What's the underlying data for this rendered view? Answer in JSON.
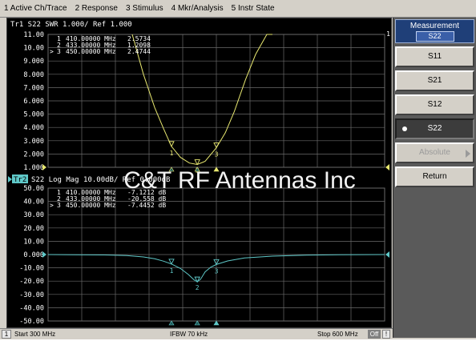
{
  "menu": [
    "1 Active Ch/Trace",
    "2 Response",
    "3 Stimulus",
    "4 Mkr/Analysis",
    "5 Instr State"
  ],
  "colors": {
    "trace1": "#e8e870",
    "trace2": "#5fc8c8",
    "grid": "#6a6a6a",
    "text_white": "#ffffff",
    "trace2_label_bg": "#5fc8c8",
    "watermark": "#ffffff"
  },
  "watermark": "C&T RF Antennas Inc",
  "trace1": {
    "header": "Tr1 S22 SWR 1.000/ Ref 1.000",
    "end_marker_label": "1",
    "y_ticks": [
      "11.00",
      "10.00",
      "9.000",
      "8.000",
      "7.000",
      "6.000",
      "5.000",
      "4.000",
      "3.000",
      "2.000",
      "1.000"
    ],
    "markers": [
      {
        "id": "1",
        "prefix": "",
        "freq": "410.00000 MHz",
        "value": "2.5734",
        "trace_value": 2.5734
      },
      {
        "id": "2",
        "prefix": "",
        "freq": "433.00000 MHz",
        "value": "1.2098",
        "trace_value": 1.2098
      },
      {
        "id": "3",
        "prefix": ">",
        "freq": "450.00000 MHz",
        "value": "2.4744",
        "trace_value": 2.4744
      }
    ]
  },
  "trace2": {
    "header_label": "Tr2",
    "header": "S22 Log Mag 10.00dB/ Ref 0.000dB",
    "y_ticks": [
      "50.00",
      "40.00",
      "30.00",
      "20.00",
      "10.00",
      "0.000",
      "-10.00",
      "-20.00",
      "-30.00",
      "-40.00",
      "-50.00"
    ],
    "markers": [
      {
        "id": "1",
        "prefix": "",
        "freq": "410.00000 MHz",
        "value": "-7.1212 dB",
        "trace_value": -7.1212
      },
      {
        "id": "2",
        "prefix": "",
        "freq": "433.00000 MHz",
        "value": "-20.558 dB",
        "trace_value": -20.558
      },
      {
        "id": "3",
        "prefix": ">",
        "freq": "450.00000 MHz",
        "value": "-7.4452 dB",
        "trace_value": -7.4452
      }
    ]
  },
  "softkeys": {
    "title": "Measurement",
    "current": "S22",
    "buttons": [
      {
        "label": "S11",
        "state": "normal"
      },
      {
        "label": "S21",
        "state": "normal"
      },
      {
        "label": "S12",
        "state": "normal"
      },
      {
        "label": "S22",
        "state": "selected"
      },
      {
        "label": "Absolute",
        "state": "disabled"
      },
      {
        "label": "Return",
        "state": "normal"
      }
    ]
  },
  "status": {
    "channel": "1",
    "start": "Start 300 MHz",
    "ifbw": "IFBW 70 kHz",
    "stop": "Stop 600 MHz",
    "off_badge": "Off",
    "alert": "!"
  },
  "chart_data": [
    {
      "type": "line",
      "title": "Tr1 S22 SWR 1.000/ Ref 1.000",
      "xlabel": "",
      "ylabel": "",
      "xlim": [
        300,
        600
      ],
      "ylim": [
        1,
        11
      ],
      "series": [
        {
          "x": [
            375,
            385,
            395,
            403,
            410,
            418,
            426,
            433,
            440,
            450,
            458,
            466,
            476,
            485,
            495,
            500
          ],
          "y": [
            11.0,
            8.0,
            5.5,
            3.9,
            2.57,
            1.75,
            1.32,
            1.21,
            1.45,
            2.47,
            3.6,
            5.2,
            7.6,
            9.5,
            11.0,
            11.0
          ]
        }
      ],
      "markers": [
        {
          "x": 410,
          "y": 2.5734
        },
        {
          "x": 433,
          "y": 1.2098
        },
        {
          "x": 450,
          "y": 2.4744
        }
      ]
    },
    {
      "type": "line",
      "title": "S22 Log Mag 10.00dB/ Ref 0.000dB",
      "xlabel": "",
      "ylabel": "",
      "xlim": [
        300,
        600
      ],
      "ylim": [
        -50,
        50
      ],
      "series": [
        {
          "x": [
            300,
            320,
            350,
            370,
            385,
            395,
            403,
            410,
            418,
            425,
            430,
            433,
            436,
            440,
            445,
            450,
            460,
            475,
            500,
            530,
            560,
            600
          ],
          "y": [
            0.0,
            -0.1,
            -0.3,
            -0.8,
            -1.8,
            -3.2,
            -5.0,
            -7.12,
            -10.5,
            -15.0,
            -19.0,
            -20.56,
            -18.5,
            -13.0,
            -9.5,
            -7.45,
            -4.8,
            -2.6,
            -1.2,
            -0.5,
            -0.2,
            0.0
          ]
        }
      ],
      "markers": [
        {
          "x": 410,
          "y": -7.1212
        },
        {
          "x": 433,
          "y": -20.558
        },
        {
          "x": 450,
          "y": -7.4452
        }
      ]
    }
  ]
}
